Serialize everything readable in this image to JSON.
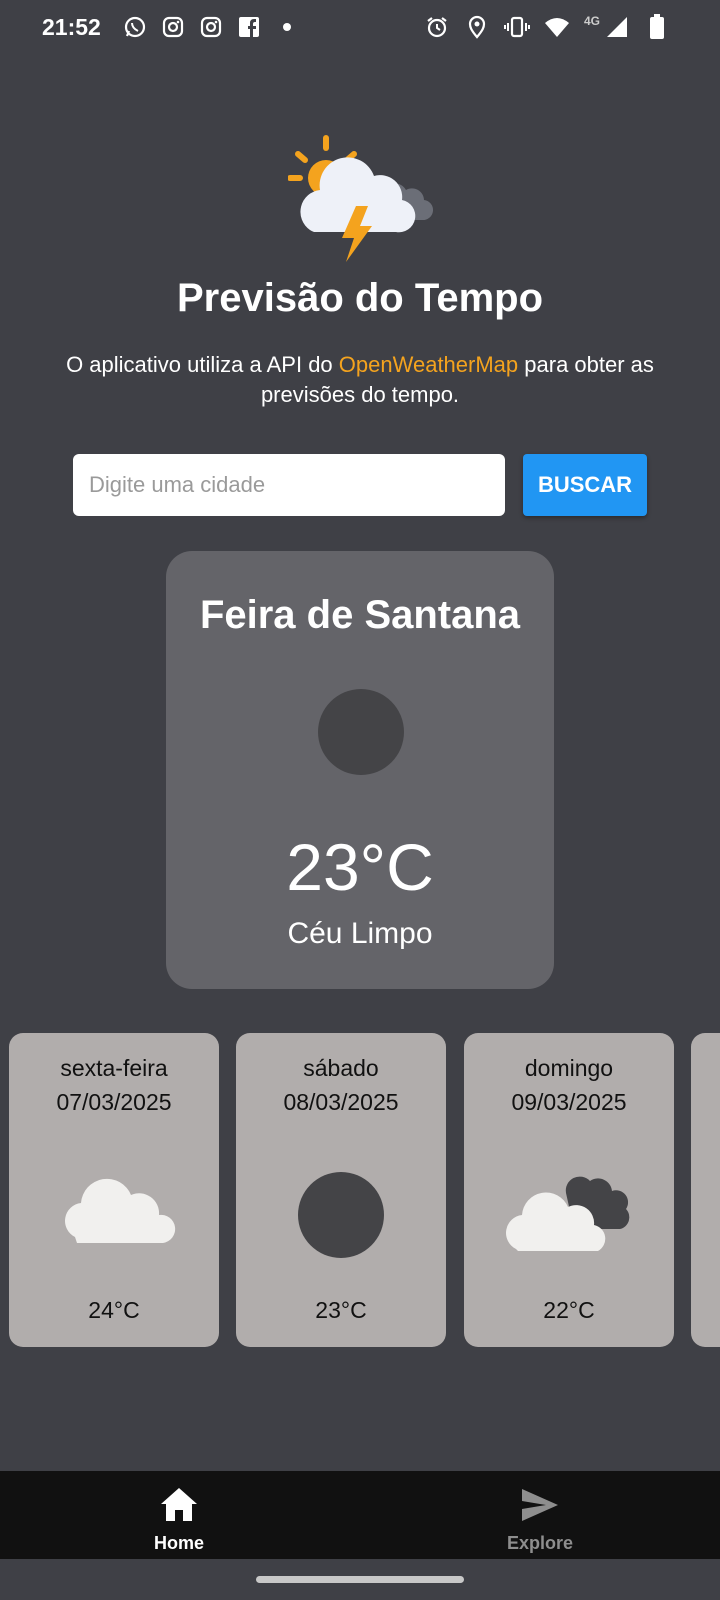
{
  "status_bar": {
    "time": "21:52",
    "network": "4G",
    "left_icons": [
      "whatsapp-icon",
      "instagram-icon",
      "instagram-icon",
      "facebook-icon",
      "dot-icon"
    ],
    "right_icons": [
      "alarm-icon",
      "location-icon",
      "vibrate-icon",
      "wifi-icon",
      "signal-icon",
      "battery-icon"
    ]
  },
  "header": {
    "logo_icon": "weather-storm-logo-icon",
    "title": "Previsão do Tempo",
    "description_prefix": "O aplicativo utiliza a API do ",
    "description_highlight": "OpenWeatherMap",
    "description_suffix": " para obter as previsões do tempo.",
    "highlight_color": "#f4a31e"
  },
  "search": {
    "placeholder": "Digite uma cidade",
    "value": "",
    "button_label": "BUSCAR",
    "button_color": "#2196f3"
  },
  "current": {
    "city": "Feira de Santana",
    "icon": "clear-sky-icon",
    "temperature": "23°C",
    "description": "Céu Limpo"
  },
  "forecast": [
    {
      "day": "sexta-feira",
      "date": "07/03/2025",
      "icon": "cloud-icon",
      "temp": "24°C"
    },
    {
      "day": "sábado",
      "date": "08/03/2025",
      "icon": "clear-sky-icon",
      "temp": "23°C"
    },
    {
      "day": "domingo",
      "date": "09/03/2025",
      "icon": "broken-clouds-icon",
      "temp": "22°C"
    }
  ],
  "bottom_nav": {
    "items": [
      {
        "label": "Home",
        "icon": "home-icon",
        "active": true
      },
      {
        "label": "Explore",
        "icon": "send-icon",
        "active": false
      }
    ]
  },
  "colors": {
    "background": "#3f4046",
    "card": "#646469",
    "forecast_card": "#b1adac"
  }
}
